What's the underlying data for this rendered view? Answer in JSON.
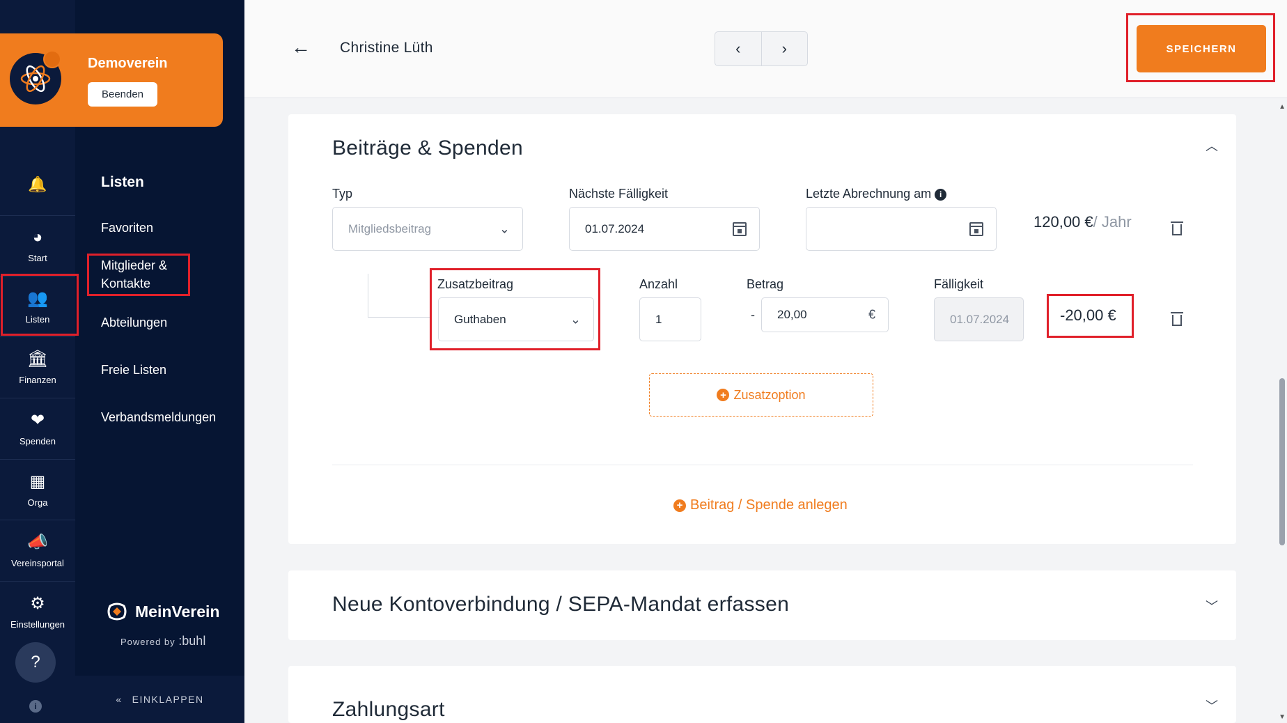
{
  "org": {
    "name": "Demoverein",
    "end_button": "Beenden"
  },
  "rail": {
    "items": [
      {
        "icon": "gauge-icon",
        "glyph": "◕",
        "label": "Start"
      },
      {
        "icon": "users-icon",
        "glyph": "👥",
        "label": "Listen"
      },
      {
        "icon": "bank-icon",
        "glyph": "🏛",
        "label": "Finanzen"
      },
      {
        "icon": "heart-hand-icon",
        "glyph": "❤",
        "label": "Spenden"
      },
      {
        "icon": "calendar-grid-icon",
        "glyph": "▦",
        "label": "Orga"
      },
      {
        "icon": "megaphone-icon",
        "glyph": "📣",
        "label": "Vereinsportal"
      },
      {
        "icon": "gear-icon",
        "glyph": "⚙",
        "label": "Einstellungen"
      }
    ]
  },
  "nav": {
    "title": "Listen",
    "links": [
      "Favoriten",
      "Mitglieder & Kontakte",
      "Abteilungen",
      "Freie Listen",
      "Verbandsmeldungen"
    ],
    "brand": "MeinVerein",
    "powered_by": "Powered by",
    "powered_brand": ":buhl",
    "collapse_label": "EINKLAPPEN"
  },
  "header": {
    "person_name": "Christine Lüth",
    "save_label": "SPEICHERN"
  },
  "contributions": {
    "title": "Beiträge & Spenden",
    "typ_label": "Typ",
    "typ_value": "Mitgliedsbeitrag",
    "next_due_label": "Nächste Fälligkeit",
    "next_due_value": "01.07.2024",
    "last_billing_label": "Letzte Abrechnung am",
    "last_billing_value": "",
    "amount": "120,00 €",
    "amount_period": "/ Jahr",
    "extra": {
      "type_label": "Zusatzbeitrag",
      "type_value": "Guthaben",
      "count_label": "Anzahl",
      "count_value": "1",
      "amount_label": "Betrag",
      "amount_sign": "-",
      "amount_value": "20,00",
      "currency": "€",
      "due_label": "Fälligkeit",
      "due_value": "01.07.2024",
      "total": "-20,00 €"
    },
    "add_option_label": "Zusatzoption",
    "add_contribution_label": "Beitrag / Spende anlegen"
  },
  "sepa": {
    "title": "Neue Kontoverbindung / SEPA-Mandat erfassen"
  },
  "payment": {
    "title": "Zahlungsart"
  },
  "colors": {
    "accent": "#f07c1e",
    "sidebar": "#061533",
    "highlight": "#e0202a"
  }
}
